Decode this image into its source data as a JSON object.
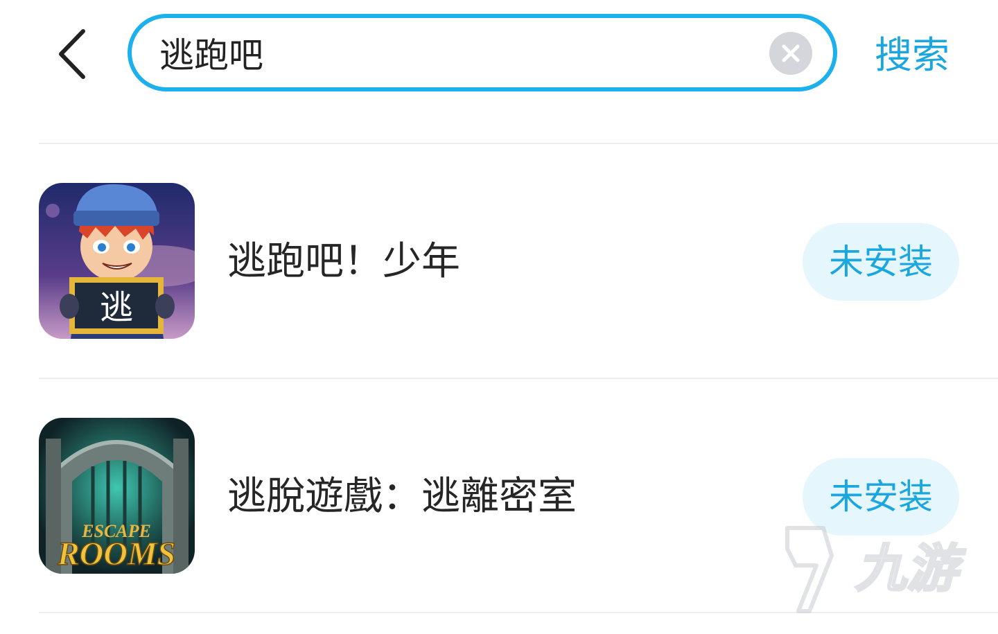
{
  "header": {
    "back_icon": "chevron-left-icon",
    "search": {
      "value": "逃跑吧",
      "clear_icon": "clear-circle-icon"
    },
    "search_label": "搜索"
  },
  "results": [
    {
      "name": "逃跑吧！少年",
      "icon": "game-icon-boy-with-sign",
      "icon_text": "逃",
      "status": "未安装"
    },
    {
      "name": "逃脫遊戲：逃離密室",
      "icon": "game-icon-escape-rooms",
      "icon_text_top": "ESCAPE",
      "icon_text_bottom": "ROOMS",
      "status": "未安装"
    }
  ],
  "watermark": {
    "text": "九游",
    "icon": "9game-logo-icon"
  },
  "colors": {
    "accent": "#1aa6de",
    "search_border": "#1cb1ec",
    "button_bg": "#e6f6fd",
    "divider": "#eeeeee",
    "text": "#262626"
  }
}
